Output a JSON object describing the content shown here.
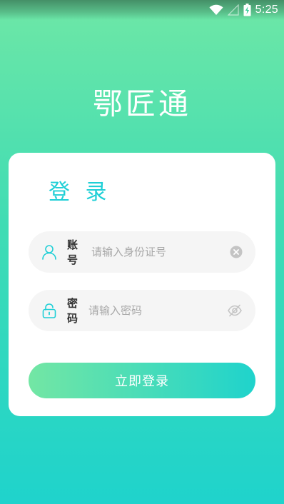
{
  "status_bar": {
    "time": "5:25",
    "icons": [
      "wifi-icon",
      "signal-icon",
      "battery-charging-icon"
    ]
  },
  "app": {
    "title": "鄂匠通"
  },
  "login": {
    "heading": "登 录",
    "account": {
      "label": "账号",
      "placeholder": "请输入身份证号",
      "value": "",
      "icon": "user-icon",
      "action_icon": "clear-icon"
    },
    "password": {
      "label": "密码",
      "placeholder": "请输入密码",
      "value": "",
      "icon": "lock-icon",
      "action_icon": "eye-off-icon"
    },
    "submit_label": "立即登录"
  },
  "colors": {
    "accent": "#1fd3cc",
    "gradient_start": "#73e6a4",
    "field_bg": "#f5f5f5",
    "placeholder": "#a8a8a8"
  }
}
